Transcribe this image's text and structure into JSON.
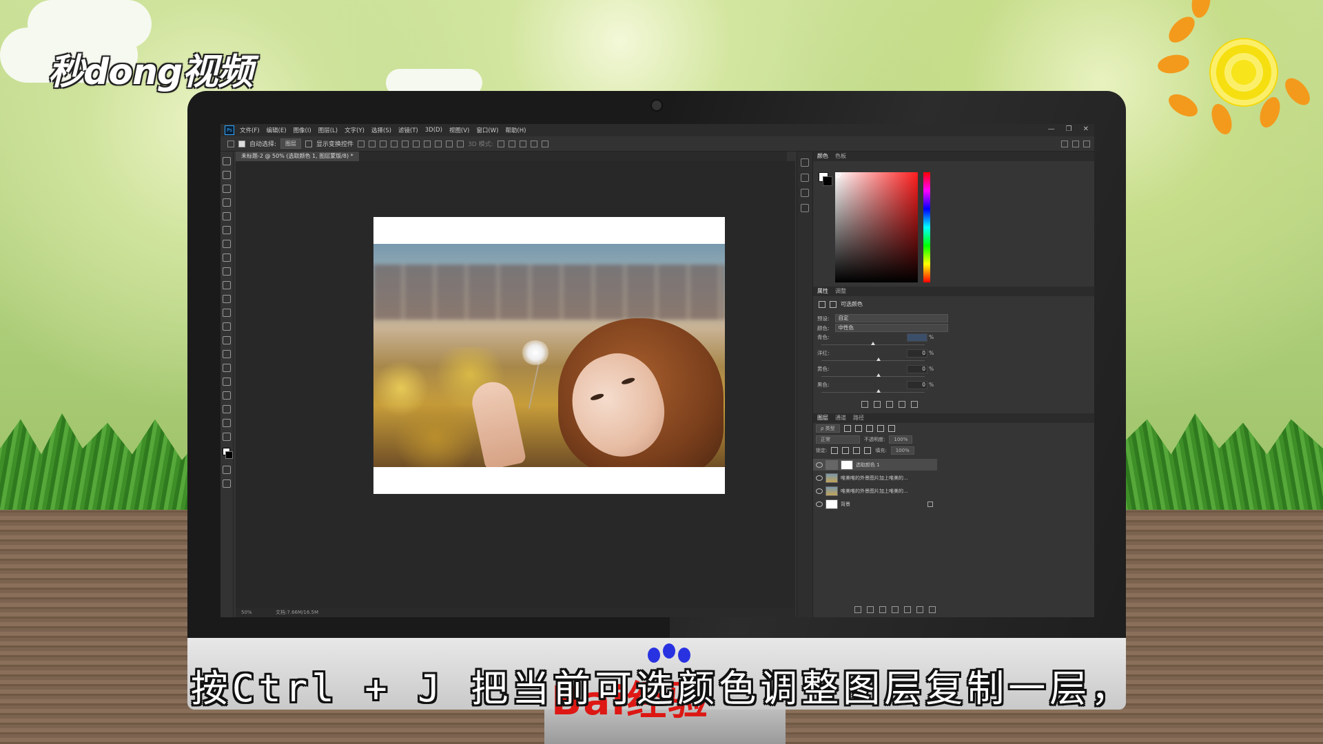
{
  "video": {
    "logo": "秒dong视频",
    "subtitle": "按Ctrl + J 把当前可选颜色调整图层复制一层，",
    "watermark": "Bai经验"
  },
  "photoshop": {
    "app_icon": "Ps",
    "menu": [
      "文件(F)",
      "编辑(E)",
      "图像(I)",
      "图层(L)",
      "文字(Y)",
      "选择(S)",
      "滤镜(T)",
      "3D(D)",
      "视图(V)",
      "窗口(W)",
      "帮助(H)"
    ],
    "window_controls": [
      "—",
      "❐",
      "✕"
    ],
    "options": {
      "auto_select_label": "自动选择:",
      "auto_select_value": "图层",
      "show_transform_label": "显示变换控件",
      "mode_3d_label": "3D 模式:"
    },
    "document_tab": "未标题-2 @ 50% (选取颜色 1, 图层蒙版/8) *",
    "status": {
      "zoom": "50%",
      "doc_size": "文档:7.66M/16.5M"
    },
    "color_panel": {
      "tabs": [
        "颜色",
        "色板"
      ]
    },
    "properties_panel": {
      "tabs": [
        "属性",
        "调整"
      ],
      "title": "可选颜色",
      "preset_label": "预设:",
      "preset_value": "自定",
      "colors_label": "颜色:",
      "colors_value": "中性色",
      "sliders": [
        {
          "label": "青色:",
          "value": "",
          "unit": "%",
          "position": 0.5
        },
        {
          "label": "洋红:",
          "value": "0",
          "unit": "%",
          "position": 0.55
        },
        {
          "label": "黄色:",
          "value": "0",
          "unit": "%",
          "position": 0.55
        },
        {
          "label": "黑色:",
          "value": "0",
          "unit": "%",
          "position": 0.55
        }
      ]
    },
    "layers_panel": {
      "tabs": [
        "图层",
        "通道",
        "路径"
      ],
      "filter_label": "ρ 类型",
      "blend_mode": "正常",
      "opacity_label": "不透明度:",
      "opacity_value": "100%",
      "lock_label": "锁定:",
      "fill_label": "填充:",
      "fill_value": "100%",
      "layers": [
        {
          "name": "选取颜色 1",
          "type": "adjustment",
          "selected": true
        },
        {
          "name": "唯美唯的外景图片加上唯美的...",
          "type": "photo",
          "selected": false
        },
        {
          "name": "唯美唯的外景图片加上唯美的...",
          "type": "photo",
          "selected": false
        },
        {
          "name": "背景",
          "type": "background",
          "selected": false,
          "locked": true
        }
      ]
    }
  }
}
